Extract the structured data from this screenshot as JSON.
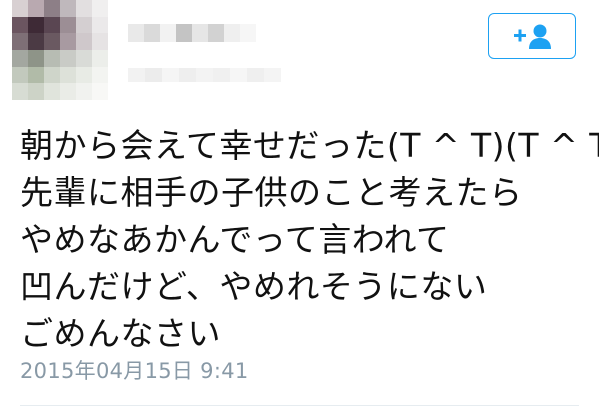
{
  "follow_button": {
    "icon": "add-person-icon",
    "color": "#1da1f2"
  },
  "tweet": {
    "lines": [
      "朝から会えて幸せだった(T ^ T)(T ^ T)",
      "先輩に相手の子供のこと考えたら",
      "やめなあかんでって言われて",
      "凹んだけど、やめれそうにない",
      "ごめんなさい"
    ],
    "timestamp": "2015年04月15日 9:41"
  },
  "colors": {
    "accent": "#1da1f2",
    "text": "#111111",
    "meta": "#8899a6"
  }
}
